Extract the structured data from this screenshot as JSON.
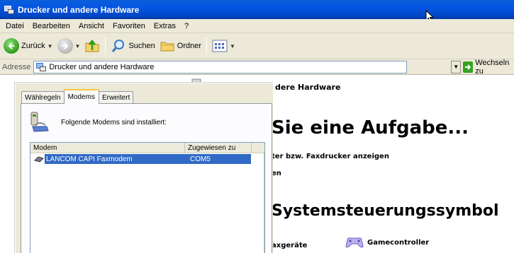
{
  "window": {
    "title": "Drucker und andere Hardware"
  },
  "menu": {
    "items": [
      "Datei",
      "Bearbeiten",
      "Ansicht",
      "Favoriten",
      "Extras",
      "?"
    ]
  },
  "toolbar": {
    "back_label": "Zurück",
    "search_label": "Suchen",
    "folders_label": "Ordner"
  },
  "address": {
    "label": "Adresse",
    "value": "Drucker und andere Hardware",
    "go_label": "Wechseln zu"
  },
  "content": {
    "section_title": "dere Hardware",
    "task_heading": "Sie eine Aufgabe...",
    "task_link_1": "ter bzw. Faxdrucker anzeigen",
    "task_link_2": "en",
    "cp_heading": "Systemsteuerungssymbol",
    "cp_item_1": "axgeräte",
    "cp_item_2": "Gamecontroller"
  },
  "dialog": {
    "tabs": [
      "Wählregeln",
      "Modems",
      "Erweitert"
    ],
    "active_tab": "Modems",
    "info_text": "Folgende Modems sind installiert:",
    "columns": {
      "modem": "Modem",
      "assigned": "Zugewiesen zu"
    },
    "rows": [
      {
        "modem": "LANCOM CAPI Faxmodem",
        "port": "COM5",
        "selected": true
      }
    ]
  },
  "colors": {
    "titlebar": "#0355e3",
    "chrome": "#ece9d8",
    "selection": "#316ac5",
    "active_tab_accent": "#ffc83c"
  }
}
